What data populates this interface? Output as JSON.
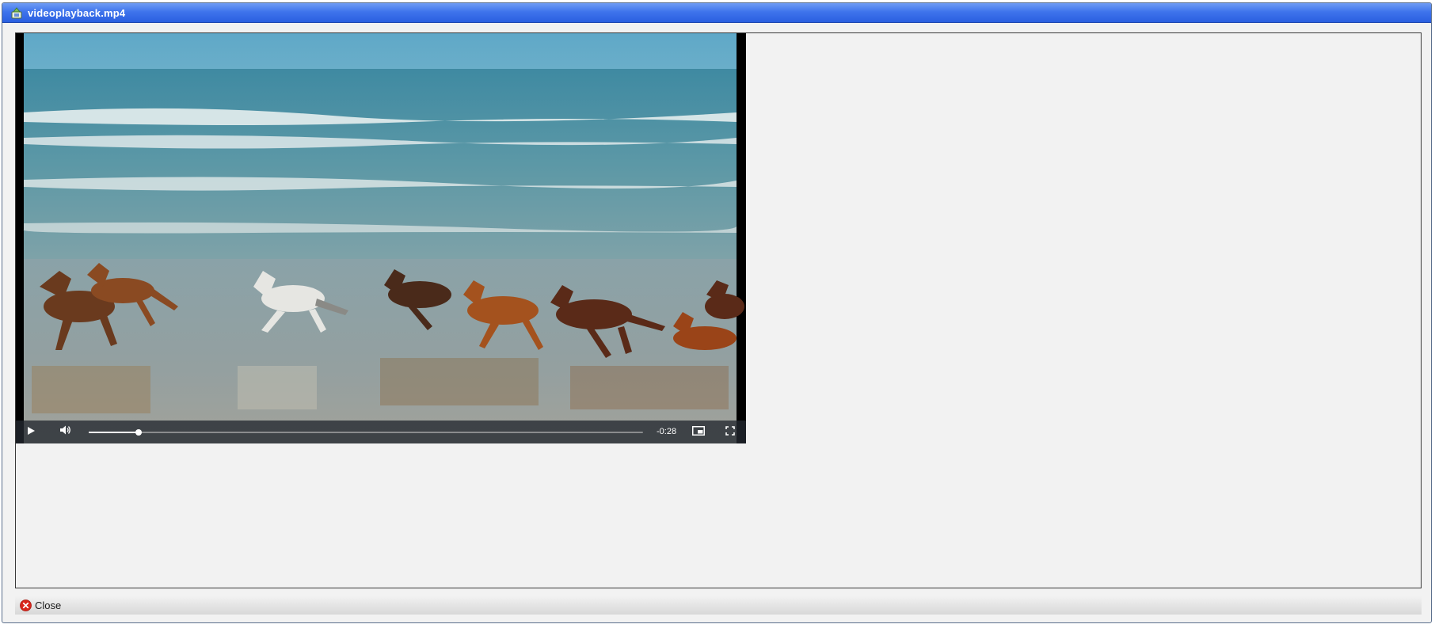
{
  "window": {
    "title": "videoplayback.mp4",
    "title_icon": "video-file-icon"
  },
  "player": {
    "frame_description_icon": "video-frame",
    "time_remaining": "-0:28",
    "progress": 0.09,
    "controls": {
      "play_icon": "play-icon",
      "volume_icon": "volume-icon",
      "pip_icon": "picture-in-picture-icon",
      "fullscreen_icon": "fullscreen-icon"
    }
  },
  "footer": {
    "close_label": "Close",
    "close_icon": "close-icon"
  },
  "colors": {
    "titlebar": "#3f74ec",
    "window_bg": "#f2f2f2",
    "close_icon_red": "#d9261c"
  }
}
